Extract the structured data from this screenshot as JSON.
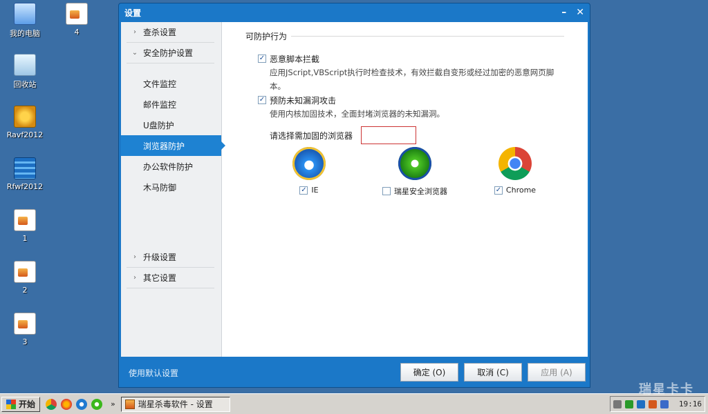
{
  "desktop": {
    "icons": [
      {
        "label": "我的电脑"
      },
      {
        "label": "4"
      },
      {
        "label": "回收站"
      },
      {
        "label": "Ravf2012"
      },
      {
        "label": "Rfwf2012"
      },
      {
        "label": "1"
      },
      {
        "label": "2"
      },
      {
        "label": "3"
      }
    ]
  },
  "window": {
    "title": "设置",
    "minimize_glyph": "–",
    "close_glyph": "✕"
  },
  "sidebar": {
    "groups": [
      {
        "label": "查杀设置",
        "chevron": "›"
      },
      {
        "label": "安全防护设置",
        "chevron": "⌄"
      },
      {
        "label": "升级设置",
        "chevron": "›"
      },
      {
        "label": "其它设置",
        "chevron": "›"
      }
    ],
    "items": [
      {
        "label": "文件监控"
      },
      {
        "label": "邮件监控"
      },
      {
        "label": "U盘防护"
      },
      {
        "label": "浏览器防护"
      },
      {
        "label": "办公软件防护"
      },
      {
        "label": "木马防御"
      }
    ]
  },
  "content": {
    "section_title": "可防护行为",
    "options": [
      {
        "label": "恶意脚本拦截",
        "checked": "✓",
        "desc": "应用JScript,VBScript执行时检查技术，有效拦截自变形或经过加密的恶意网页脚本。"
      },
      {
        "label": "预防未知漏洞攻击",
        "checked": "✓",
        "desc": "使用内核加固技术，全面封堵浏览器的未知漏洞。"
      }
    ],
    "browser_select_label": "请选择需加固的浏览器",
    "browsers": [
      {
        "label": "IE",
        "checked": "✓"
      },
      {
        "label": "瑞星安全浏览器",
        "checked": ""
      },
      {
        "label": "Chrome",
        "checked": "✓"
      }
    ]
  },
  "footer": {
    "default_link": "使用默认设置",
    "ok": "确定 (O)",
    "cancel": "取消 (C)",
    "apply": "应用 (A)"
  },
  "taskbar": {
    "start": "开始",
    "more": "»",
    "task_label": "瑞星杀毒软件 - 设置",
    "clock": "19:16"
  },
  "watermark": "瑞星卡卡"
}
